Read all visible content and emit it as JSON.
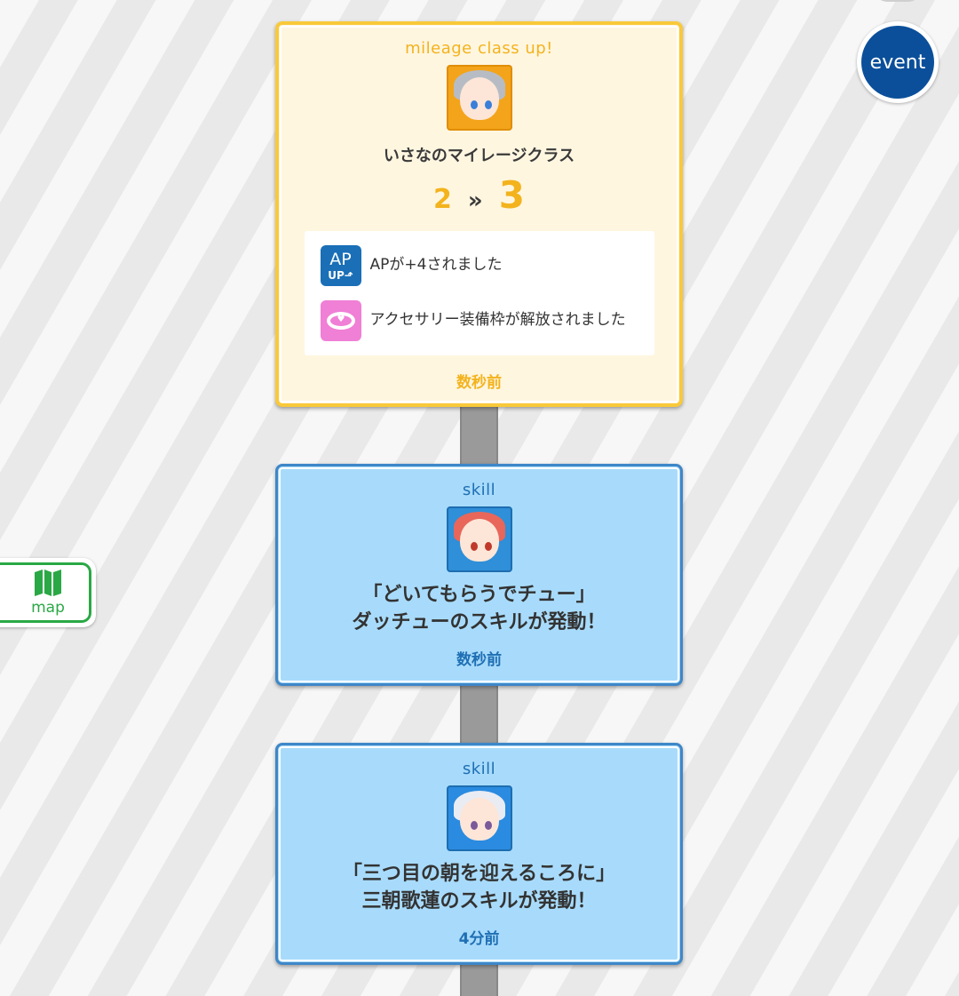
{
  "side": {
    "event_label": "event",
    "map_label": "map",
    "map_icon": "map-icon"
  },
  "mileage_card": {
    "type_label": "mileage class up!",
    "title": "いさなのマイレージクラス",
    "class_from": "2",
    "class_arrow": "»",
    "class_to": "3",
    "rewards": [
      {
        "icon": "ap-up-icon",
        "icon_line1": "AP",
        "icon_line2": "UP⬏",
        "text": "APが+4されました"
      },
      {
        "icon": "accessory-ring-icon",
        "text": "アクセサリー装備枠が解放されました"
      }
    ],
    "time": "数秒前",
    "colors": {
      "accent": "#f3b31d",
      "background": "#fff6e0"
    }
  },
  "skill_cards": [
    {
      "type_label": "skill",
      "line1": "「どいてもらうでチュー」",
      "line2": "ダッチューのスキルが発動！",
      "time": "数秒前"
    },
    {
      "type_label": "skill",
      "line1": "「三つ目の朝を迎えるころに」",
      "line2": "三朝歌蓮のスキルが発動！",
      "time": "4分前"
    }
  ],
  "colors": {
    "skill_background": "#a8dbfb",
    "skill_accent": "#1f6fb4",
    "connector": "#9a9a9a"
  }
}
